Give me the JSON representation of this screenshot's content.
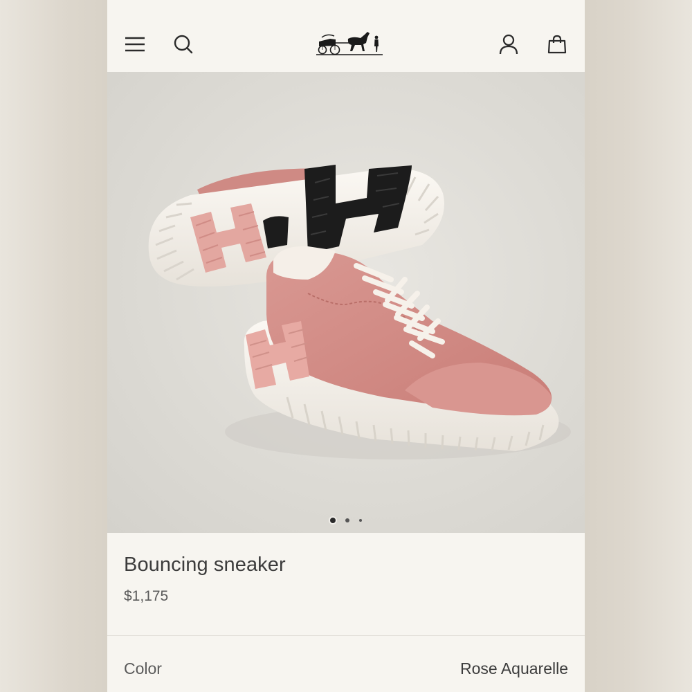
{
  "header": {
    "menu_icon": "hamburger-menu-icon",
    "search_icon": "search-icon",
    "logo_icon": "carriage-logo",
    "account_icon": "user-account-icon",
    "bag_icon": "shopping-bag-icon"
  },
  "gallery": {
    "image": "pink sneaker product photo",
    "dots_total": 3,
    "dots_active": 1
  },
  "product": {
    "title": "Bouncing sneaker",
    "price": "$1,175",
    "color_label": "Color",
    "color_value": "Rose Aquarelle"
  },
  "colors": {
    "background": "#f7f5f0",
    "shoe_pink": "#d58d86",
    "sole_white": "#f4f0ea",
    "sole_black": "#1c1c1c"
  }
}
